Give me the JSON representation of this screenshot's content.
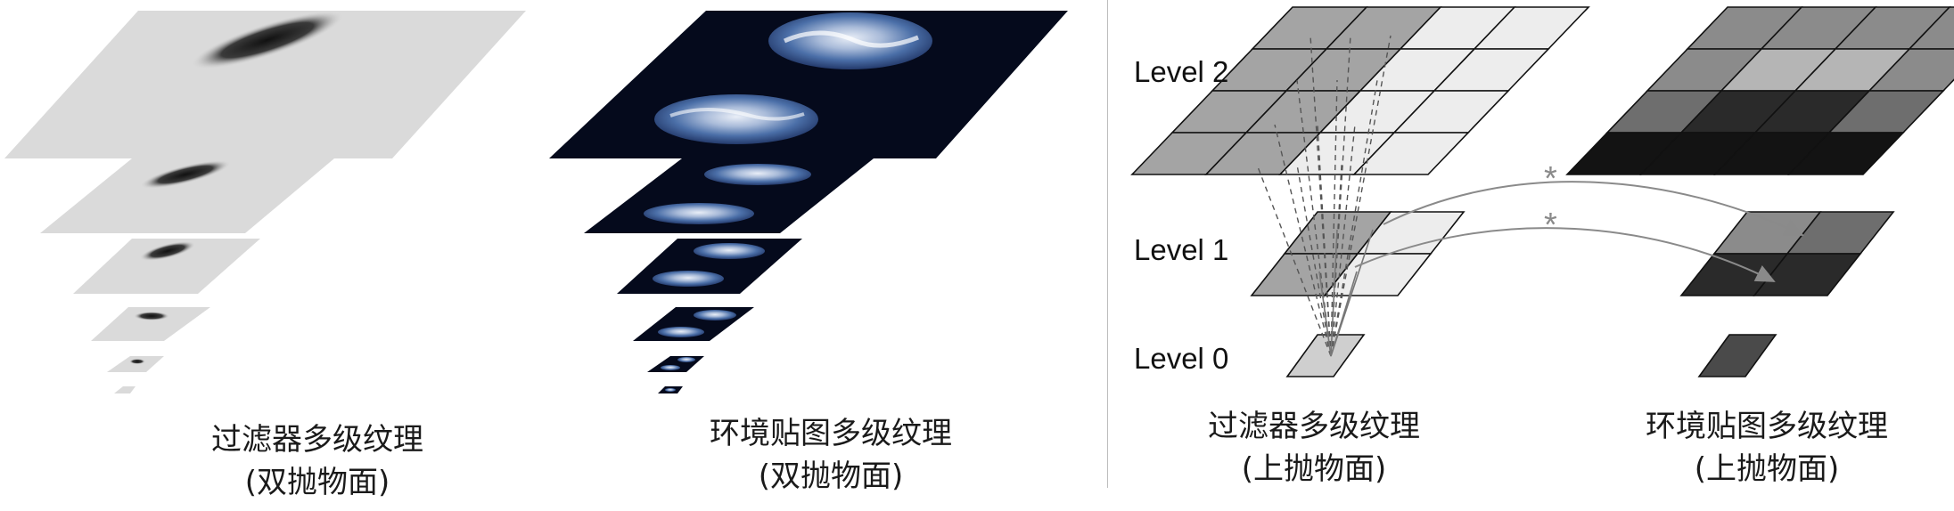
{
  "captions": {
    "left1": {
      "line1": "过滤器多级纹理",
      "line2": "(双抛物面)"
    },
    "left2": {
      "line1": "环境贴图多级纹理",
      "line2": "(双抛物面)"
    },
    "right1": {
      "line1": "过滤器多级纹理",
      "line2": "(上抛物面)"
    },
    "right2": {
      "line1": "环境贴图多级纹理",
      "line2": "(上抛物面)"
    }
  },
  "levels": {
    "level2": "Level 2",
    "level1": "Level 1",
    "level0": "Level 0"
  },
  "annotations": {
    "convolution_symbol": "*"
  },
  "colors": {
    "plane_gray": "#dadada",
    "plane_dark": "#050a1c",
    "env_blue": "#4b6fa8",
    "grid_line": "#111111",
    "arrow_gray": "#8a8a8a"
  }
}
